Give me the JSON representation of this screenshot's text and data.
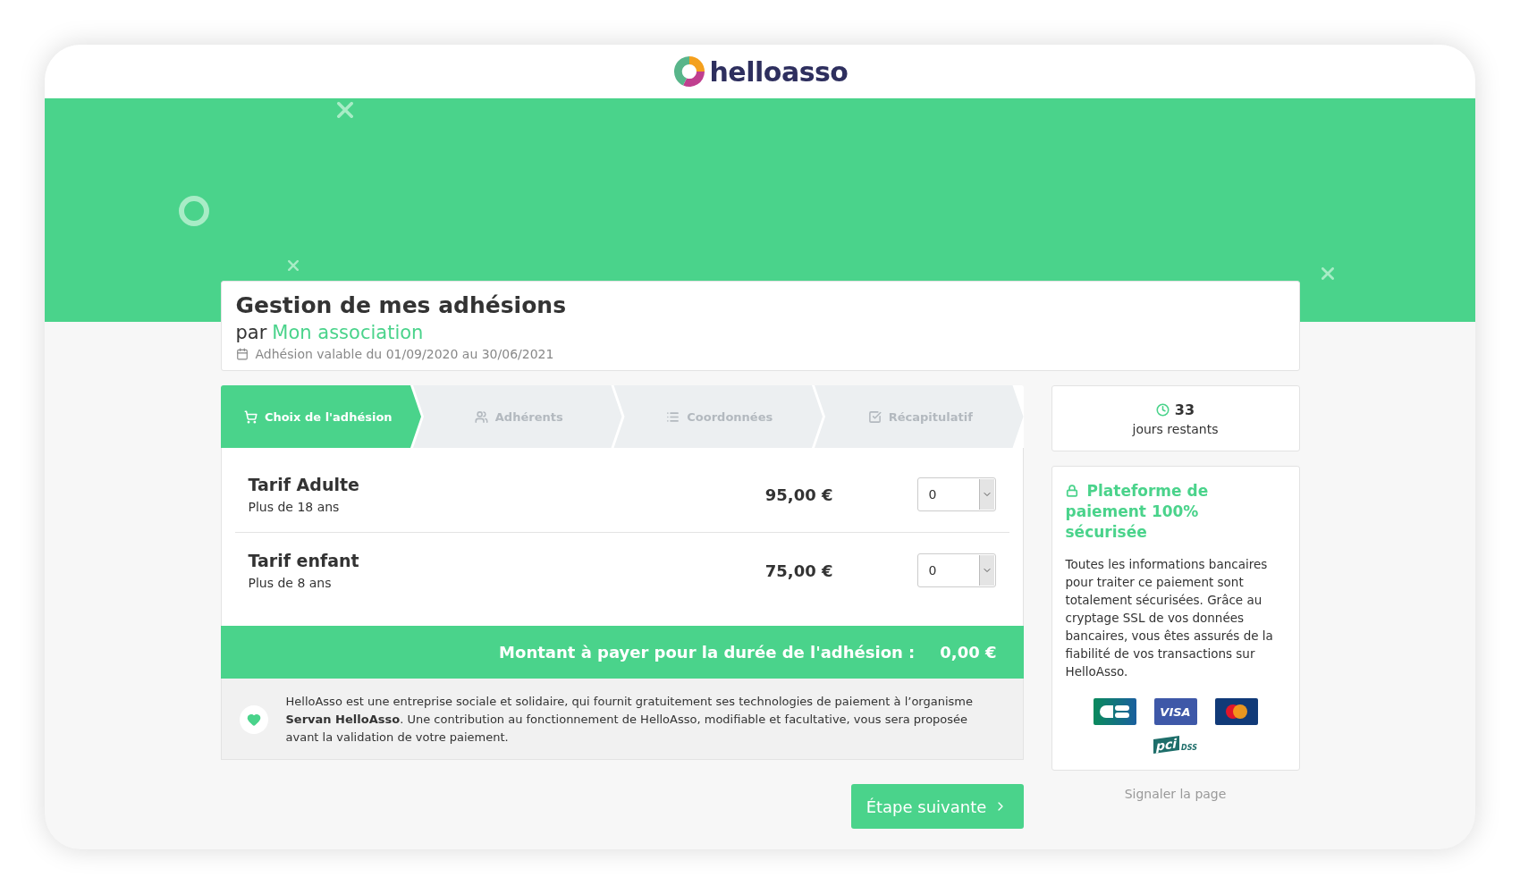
{
  "header": {
    "logo_text": "helloasso"
  },
  "form": {
    "title": "Gestion de mes adhésions",
    "by": "par",
    "organization": "Mon association",
    "validity": "Adhésion valable du 01/09/2020 au 30/06/2021"
  },
  "steps": [
    {
      "label": "Choix de l'adhésion",
      "selected": true
    },
    {
      "label": "Adhérents",
      "selected": false
    },
    {
      "label": "Coordonnées",
      "selected": false
    },
    {
      "label": "Récapitulatif",
      "selected": false
    }
  ],
  "tariffs": [
    {
      "name": "Tarif Adulte",
      "description": "Plus de 18 ans",
      "price": "95,00 €",
      "quantity": "0"
    },
    {
      "name": "Tarif enfant",
      "description": "Plus de 8 ans",
      "price": "75,00 €",
      "quantity": "0"
    }
  ],
  "total": {
    "label": "Montant à payer pour la durée de l'adhésion :",
    "amount": "0,00 €"
  },
  "note": "HelloAsso est une entreprise sociale et solidaire, qui fournit gratuitement ses technologies de paiement à l’organisme **Servan HelloAsso**. Une contribution au fonctionnement de HelloAsso, modifiable et facultative, vous sera proposée avant la validation de votre paiement.",
  "next_button": "Étape suivante",
  "countdown": {
    "value": "33",
    "label": "jours restants"
  },
  "security": {
    "title": "Plateforme de paiement 100% sécurisée",
    "text": "Toutes les informations bancaires pour traiter ce paiement sont totalement sécurisées. Grâce au cryptage SSL de vos données bancaires, vous êtes assurés de la fiabilité de vos transactions sur HelloAsso.",
    "cards": [
      {
        "kind": "cb"
      },
      {
        "kind": "visa",
        "label": "VISA"
      },
      {
        "kind": "mastercard"
      }
    ],
    "certification": {
      "label": "pci",
      "sub": "DSS"
    }
  },
  "report_link": "Signaler la page"
}
